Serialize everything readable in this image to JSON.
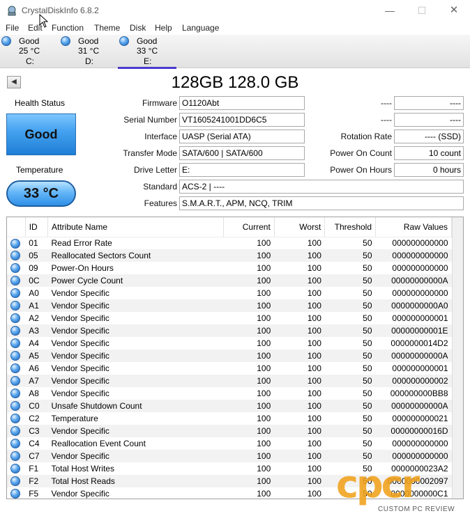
{
  "window": {
    "title": "CrystalDiskInfo 6.8.2",
    "minimize": "—",
    "maximize": "☐",
    "close": "✕"
  },
  "menu": [
    "File",
    "Edit",
    "Function",
    "Theme",
    "Disk",
    "Help",
    "Language"
  ],
  "disks": [
    {
      "status": "Good",
      "temp": "25 °C",
      "letter": "C:"
    },
    {
      "status": "Good",
      "temp": "31 °C",
      "letter": "D:"
    },
    {
      "status": "Good",
      "temp": "33 °C",
      "letter": "E:",
      "active": true
    }
  ],
  "drive": {
    "title": "128GB 128.0 GB",
    "health_label": "Health Status",
    "health_value": "Good",
    "temp_label": "Temperature",
    "temp_value": "33 °C",
    "firmware_label": "Firmware",
    "firmware": "O1120Abt",
    "serial_label": "Serial Number",
    "serial": "VT1605241001DD6C5",
    "interface_label": "Interface",
    "interface": "UASP (Serial ATA)",
    "transfer_label": "Transfer Mode",
    "transfer": "SATA/600 | SATA/600",
    "letter_label": "Drive Letter",
    "letter": "E:",
    "standard_label": "Standard",
    "standard": "ACS-2 | ----",
    "features_label": "Features",
    "features": "S.M.A.R.T., APM, NCQ, TRIM",
    "blank1_label": "----",
    "blank1": "----",
    "blank2_label": "----",
    "blank2": "----",
    "rotation_label": "Rotation Rate",
    "rotation": "---- (SSD)",
    "power_count_label": "Power On Count",
    "power_count": "10 count",
    "power_hours_label": "Power On Hours",
    "power_hours": "0 hours"
  },
  "table": {
    "headers": {
      "id": "ID",
      "name": "Attribute Name",
      "current": "Current",
      "worst": "Worst",
      "threshold": "Threshold",
      "raw": "Raw Values"
    },
    "rows": [
      {
        "id": "01",
        "name": "Read Error Rate",
        "current": "100",
        "worst": "100",
        "threshold": "50",
        "raw": "000000000000"
      },
      {
        "id": "05",
        "name": "Reallocated Sectors Count",
        "current": "100",
        "worst": "100",
        "threshold": "50",
        "raw": "000000000000"
      },
      {
        "id": "09",
        "name": "Power-On Hours",
        "current": "100",
        "worst": "100",
        "threshold": "50",
        "raw": "000000000000"
      },
      {
        "id": "0C",
        "name": "Power Cycle Count",
        "current": "100",
        "worst": "100",
        "threshold": "50",
        "raw": "00000000000A"
      },
      {
        "id": "A0",
        "name": "Vendor Specific",
        "current": "100",
        "worst": "100",
        "threshold": "50",
        "raw": "000000000000"
      },
      {
        "id": "A1",
        "name": "Vendor Specific",
        "current": "100",
        "worst": "100",
        "threshold": "50",
        "raw": "0000000000A0"
      },
      {
        "id": "A2",
        "name": "Vendor Specific",
        "current": "100",
        "worst": "100",
        "threshold": "50",
        "raw": "000000000001"
      },
      {
        "id": "A3",
        "name": "Vendor Specific",
        "current": "100",
        "worst": "100",
        "threshold": "50",
        "raw": "00000000001E"
      },
      {
        "id": "A4",
        "name": "Vendor Specific",
        "current": "100",
        "worst": "100",
        "threshold": "50",
        "raw": "0000000014D2"
      },
      {
        "id": "A5",
        "name": "Vendor Specific",
        "current": "100",
        "worst": "100",
        "threshold": "50",
        "raw": "00000000000A"
      },
      {
        "id": "A6",
        "name": "Vendor Specific",
        "current": "100",
        "worst": "100",
        "threshold": "50",
        "raw": "000000000001"
      },
      {
        "id": "A7",
        "name": "Vendor Specific",
        "current": "100",
        "worst": "100",
        "threshold": "50",
        "raw": "000000000002"
      },
      {
        "id": "A8",
        "name": "Vendor Specific",
        "current": "100",
        "worst": "100",
        "threshold": "50",
        "raw": "000000000BB8"
      },
      {
        "id": "C0",
        "name": "Unsafe Shutdown Count",
        "current": "100",
        "worst": "100",
        "threshold": "50",
        "raw": "00000000000A"
      },
      {
        "id": "C2",
        "name": "Temperature",
        "current": "100",
        "worst": "100",
        "threshold": "50",
        "raw": "000000000021"
      },
      {
        "id": "C3",
        "name": "Vendor Specific",
        "current": "100",
        "worst": "100",
        "threshold": "50",
        "raw": "00000000016D"
      },
      {
        "id": "C4",
        "name": "Reallocation Event Count",
        "current": "100",
        "worst": "100",
        "threshold": "50",
        "raw": "000000000000"
      },
      {
        "id": "C7",
        "name": "Vendor Specific",
        "current": "100",
        "worst": "100",
        "threshold": "50",
        "raw": "000000000000"
      },
      {
        "id": "F1",
        "name": "Total Host Writes",
        "current": "100",
        "worst": "100",
        "threshold": "50",
        "raw": "0000000023A2"
      },
      {
        "id": "F2",
        "name": "Total Host Reads",
        "current": "100",
        "worst": "100",
        "threshold": "50",
        "raw": "0000000002097"
      },
      {
        "id": "F5",
        "name": "Vendor Specific",
        "current": "100",
        "worst": "100",
        "threshold": "50",
        "raw": "0000000000C1"
      }
    ]
  },
  "watermark": {
    "letters": "cpcr",
    "subtitle": "CUSTOM PC REVIEW"
  },
  "colors": {
    "health_good": "#46a3f0",
    "tab_underline": "#4a3ad0",
    "watermark": "#f1a21b"
  }
}
